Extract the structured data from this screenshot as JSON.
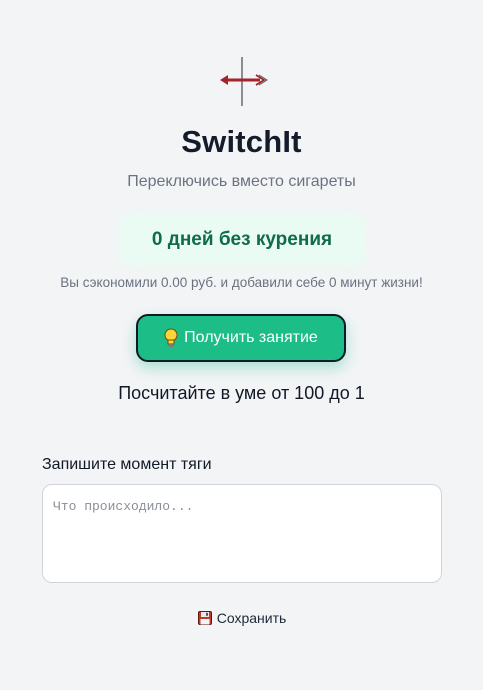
{
  "app": {
    "title": "SwitchIt",
    "subtitle": "Переключись вместо сигареты"
  },
  "stats": {
    "streak_text": "0 дней без курения",
    "savings_text": "Вы сэкономили 0.00 руб. и добавили себе 0 минут жизни!"
  },
  "activity": {
    "button_label": "Получить занятие",
    "current_activity": "Посчитайте в уме от 100 до 1"
  },
  "craving_note": {
    "label": "Запишите момент тяги",
    "value": "",
    "placeholder": "Что происходило..."
  },
  "save": {
    "label": "Сохранить"
  },
  "icons": {
    "logo": "switch-arrow-logo-icon",
    "activity": "lightbulb-icon",
    "save": "floppy-disk-icon"
  },
  "colors": {
    "accent": "#1dbd87",
    "streak_text": "#0f6b48",
    "streak_bg": "#eafbf3",
    "title": "#141b2b",
    "muted": "#6b7280"
  }
}
